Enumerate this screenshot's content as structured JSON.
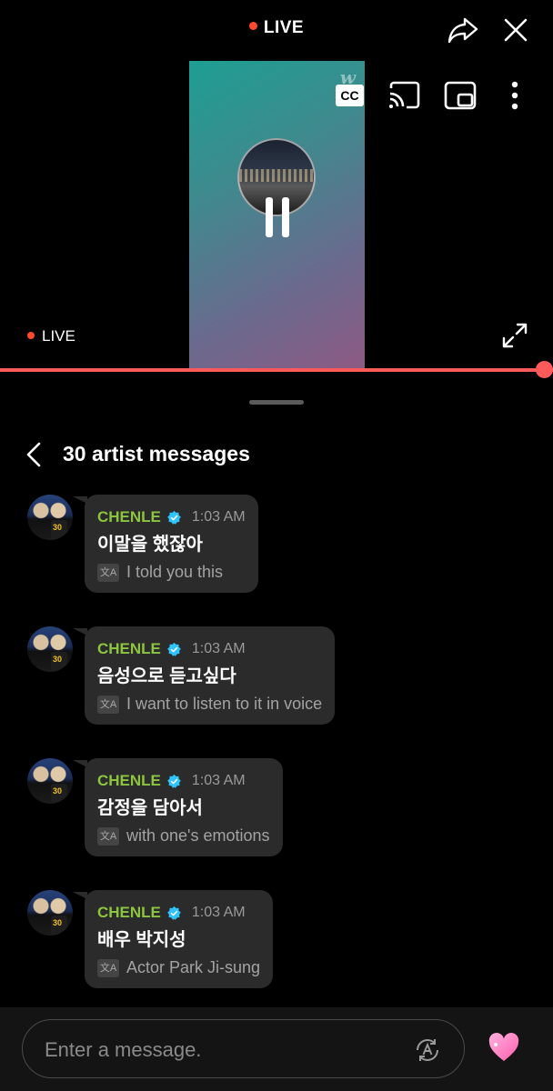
{
  "top_bar": {
    "live_label": "LIVE"
  },
  "player": {
    "watermark": "w",
    "cc_label": "CC",
    "live_label": "LIVE",
    "progress_fraction": 1.0
  },
  "chat": {
    "title": "30 artist messages",
    "messages": [
      {
        "author": "CHENLE",
        "time": "1:03 AM",
        "text": "이말을 했잖아",
        "translation": "I told you this"
      },
      {
        "author": "CHENLE",
        "time": "1:03 AM",
        "text": "음성으로 듣고싶다",
        "translation": "I want to listen to it in voice"
      },
      {
        "author": "CHENLE",
        "time": "1:03 AM",
        "text": "감정을 담아서",
        "translation": "with one's emotions"
      },
      {
        "author": "CHENLE",
        "time": "1:03 AM",
        "text": "배우 박지성",
        "translation": "Actor Park Ji-sung"
      }
    ]
  },
  "input": {
    "placeholder": "Enter a message."
  },
  "icons": {
    "share": "share-icon",
    "close": "close-icon",
    "cast": "cast-icon",
    "pip": "picture-in-picture-icon",
    "more": "more-vertical-icon",
    "pause": "pause-icon",
    "expand": "expand-icon",
    "back": "chevron-left-icon",
    "verified": "verified-badge-icon",
    "translate": "translate-icon",
    "heart": "heart-icon"
  },
  "colors": {
    "live_dot": "#ff4a2b",
    "progress": "#ff5a5a",
    "author": "#8cc63f",
    "verified": "#2ec4ff",
    "heart": "#ff7cc8"
  }
}
